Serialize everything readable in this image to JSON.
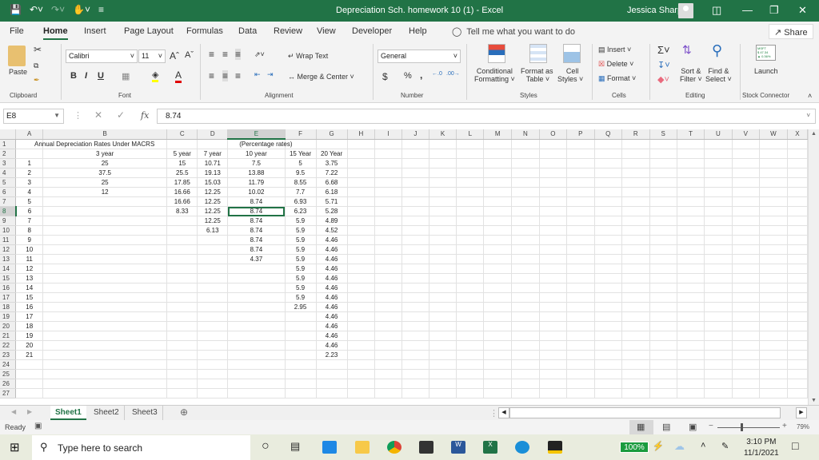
{
  "window": {
    "title": "Depreciation Sch. homework 10 (1)  -  Excel",
    "user": "Jessica Sharp"
  },
  "ribbon_tabs": [
    "File",
    "Home",
    "Insert",
    "Page Layout",
    "Formulas",
    "Data",
    "Review",
    "View",
    "Developer",
    "Help"
  ],
  "active_tab": "Home",
  "tell_me": "Tell me what you want to do",
  "share": "Share",
  "ribbon": {
    "clipboard": {
      "paste": "Paste",
      "label": "Clipboard"
    },
    "font": {
      "name": "Calibri",
      "size": "11",
      "label": "Font",
      "bold": "B",
      "italic": "I",
      "underline": "U"
    },
    "alignment": {
      "wrap": "Wrap Text",
      "merge": "Merge & Center",
      "label": "Alignment"
    },
    "number": {
      "format": "General",
      "currency": "$",
      "percent": "%",
      "comma": ",",
      "label": "Number"
    },
    "styles": {
      "conditional": "Conditional",
      "conditional2": "Formatting",
      "format_table": "Format as",
      "format_table2": "Table",
      "cell_styles": "Cell",
      "cell_styles2": "Styles",
      "label": "Styles"
    },
    "cells": {
      "insert": "Insert",
      "delete": "Delete",
      "format": "Format",
      "label": "Cells"
    },
    "editing": {
      "sort": "Sort &",
      "sort2": "Filter",
      "find": "Find &",
      "find2": "Select",
      "label": "Editing"
    },
    "stock": {
      "launch": "Launch",
      "label": "Stock Connector"
    }
  },
  "formula_bar": {
    "name_box": "E8",
    "fx": "fx",
    "value": "8.74"
  },
  "columns": [
    "A",
    "B",
    "C",
    "D",
    "E",
    "F",
    "G",
    "H",
    "I",
    "J",
    "K",
    "L",
    "M",
    "N",
    "O",
    "P",
    "Q",
    "R",
    "S",
    "T",
    "U",
    "V",
    "W",
    "X"
  ],
  "selected_cell": {
    "col": "E",
    "row": 8
  },
  "sheet": {
    "title_row": {
      "text": "Annual Depreciation Rates Under MACRS",
      "note": "(Percentage rates)"
    },
    "headers": [
      "",
      "3 year",
      "5 year",
      "7  year",
      "10 year",
      "15 Year",
      "20 Year"
    ],
    "rows": [
      [
        "1",
        "25",
        "15",
        "10.71",
        "7.5",
        "5",
        "3.75"
      ],
      [
        "2",
        "37.5",
        "25.5",
        "19.13",
        "13.88",
        "9.5",
        "7.22"
      ],
      [
        "3",
        "25",
        "17.85",
        "15.03",
        "11.79",
        "8.55",
        "6.68"
      ],
      [
        "4",
        "12",
        "16.66",
        "12.25",
        "10.02",
        "7.7",
        "6.18"
      ],
      [
        "5",
        "",
        "16.66",
        "12.25",
        "8.74",
        "6.93",
        "5.71"
      ],
      [
        "6",
        "",
        "8.33",
        "12.25",
        "8.74",
        "6.23",
        "5.28"
      ],
      [
        "7",
        "",
        "",
        "12.25",
        "8.74",
        "5.9",
        "4.89"
      ],
      [
        "8",
        "",
        "",
        "6.13",
        "8.74",
        "5.9",
        "4.52"
      ],
      [
        "9",
        "",
        "",
        "",
        "8.74",
        "5.9",
        "4.46"
      ],
      [
        "10",
        "",
        "",
        "",
        "8.74",
        "5.9",
        "4.46"
      ],
      [
        "11",
        "",
        "",
        "",
        "4.37",
        "5.9",
        "4.46"
      ],
      [
        "12",
        "",
        "",
        "",
        "",
        "5.9",
        "4.46"
      ],
      [
        "13",
        "",
        "",
        "",
        "",
        "5.9",
        "4.46"
      ],
      [
        "14",
        "",
        "",
        "",
        "",
        "5.9",
        "4.46"
      ],
      [
        "15",
        "",
        "",
        "",
        "",
        "5.9",
        "4.46"
      ],
      [
        "16",
        "",
        "",
        "",
        "",
        "2.95",
        "4.46"
      ],
      [
        "17",
        "",
        "",
        "",
        "",
        "",
        "4.46"
      ],
      [
        "18",
        "",
        "",
        "",
        "",
        "",
        "4.46"
      ],
      [
        "19",
        "",
        "",
        "",
        "",
        "",
        "4.46"
      ],
      [
        "20",
        "",
        "",
        "",
        "",
        "",
        "4.46"
      ],
      [
        "21",
        "",
        "",
        "",
        "",
        "",
        "2.23"
      ]
    ],
    "total_rows": 27
  },
  "sheet_tabs": [
    "Sheet1",
    "Sheet2",
    "Sheet3"
  ],
  "active_sheet": "Sheet1",
  "status": {
    "ready": "Ready",
    "zoom": "79%"
  },
  "taskbar": {
    "search_placeholder": "Type here to search",
    "battery": "100%",
    "time": "3:10 PM",
    "date": "11/1/2021"
  }
}
